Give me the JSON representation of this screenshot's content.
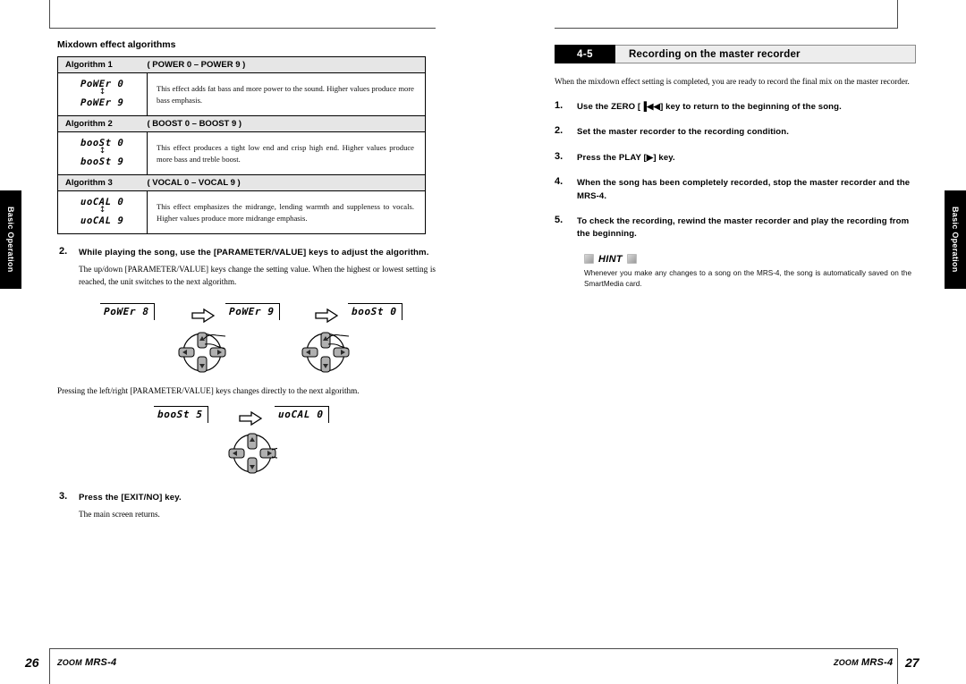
{
  "thumb_tabs": {
    "left_label": "Basic Operation",
    "right_label": "Basic Operation"
  },
  "left_page": {
    "subhead": "Mixdown effect algorithms",
    "algorithms": [
      {
        "label": "Algorithm 1",
        "range": "( POWER 0 – POWER 9 )",
        "lcd_top": "PoWEr 0",
        "lcd_bottom": "PoWEr 9",
        "description": "This effect adds fat bass and more power to the sound. Higher values produce more bass emphasis."
      },
      {
        "label": "Algorithm 2",
        "range": "( BOOST 0 – BOOST 9 )",
        "lcd_top": "booSt 0",
        "lcd_bottom": "booSt 9",
        "description": "This effect produces a tight low end and crisp high end. Higher values produce more bass and treble boost."
      },
      {
        "label": "Algorithm 3",
        "range": "( VOCAL 0 – VOCAL 9 )",
        "lcd_top": "uoCAL 0",
        "lcd_bottom": "uoCAL 9",
        "description": "This effect emphasizes the midrange, lending warmth and suppleness to vocals. Higher values produce more midrange emphasis."
      }
    ],
    "step2": {
      "number": "2.",
      "title": "While playing the song, use the [PARAMETER/VALUE] keys to adjust the algorithm.",
      "body": "The up/down [PARAMETER/VALUE] keys change the setting value. When the highest or lowest setting is reached, the unit switches to the next algorithm."
    },
    "flow1": {
      "display_1": "PoWEr 8",
      "display_2": "PoWEr 9",
      "display_3": "booSt 0",
      "arrow_glyph": "arrow-right-outline",
      "pad_1_name": "cursor-pad-up",
      "pad_2_name": "cursor-pad-up"
    },
    "mid_para": "Pressing the left/right [PARAMETER/VALUE] keys changes directly to the next algorithm.",
    "flow2": {
      "display_1": "booSt 5",
      "display_2": "uoCAL 0",
      "arrow_glyph": "arrow-right-outline",
      "pad_1_name": "cursor-pad-right"
    },
    "step3": {
      "number": "3.",
      "title": "Press the [EXIT/NO] key.",
      "body": "The main screen returns."
    }
  },
  "right_page": {
    "section_number": "4-5",
    "section_title": "Recording on the master recorder",
    "intro": "When the mixdown effect setting is completed, you are ready to record the final mix on the master recorder.",
    "steps": [
      {
        "number": "1.",
        "text": "Use the ZERO [▐◀◀] key to return to the beginning of the song."
      },
      {
        "number": "2.",
        "text": "Set the master recorder to the recording condition."
      },
      {
        "number": "3.",
        "text": "Press the PLAY [▶] key."
      },
      {
        "number": "4.",
        "text": "When the song has been completely recorded, stop the master recorder and the MRS-4."
      },
      {
        "number": "5.",
        "text": "To check the recording, rewind the master recorder and play the recording from the beginning."
      }
    ],
    "hint": {
      "label": "HINT",
      "text": "Whenever you make any changes to a song on the MRS-4, the song is automatically saved on the SmartMedia card."
    }
  },
  "footer": {
    "left_page_number": "26",
    "right_page_number": "27",
    "brand_zoom": "ZOOM",
    "brand_model": "MRS-4"
  },
  "colors": {
    "accent_black": "#000000",
    "header_gray": "#e6e6e6",
    "section_title_gray": "#ededed",
    "rule_gray": "#4a4a4a"
  }
}
